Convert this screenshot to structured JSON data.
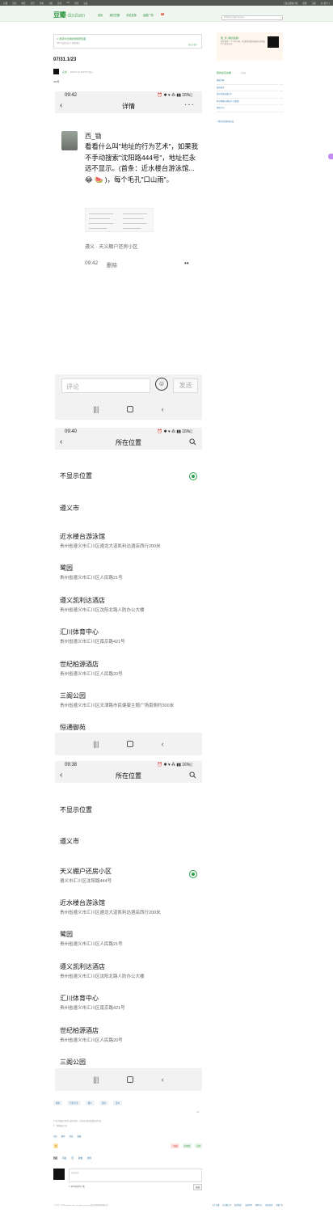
{
  "gnav": {
    "left": [
      "豆瓣",
      "读书",
      "电影",
      "音乐",
      "同城",
      "小组",
      "阅读",
      "FM",
      "时间",
      "豆品"
    ],
    "right": [
      "下载豆瓣客户端",
      "提醒",
      "豆邮",
      "的_帐号 ▾"
    ]
  },
  "header": {
    "logo": "豆瓣",
    "logo_sub": "douban",
    "nav": [
      "首页",
      "我的豆瓣",
      "浏览发现",
      "话题广场"
    ],
    "nav_badge": "新",
    "search_placeholder": "搜索你感兴趣的内容和人..."
  },
  "group": {
    "name": "吴京中文网的建筑研究组",
    "meta": "300个成员在此  小组管理员",
    "join": "加入小组 ›"
  },
  "post": {
    "title": "07/31.1/23",
    "author": "良 鹤",
    "time": "2023-07-31 09:15:51 贵州",
    "body_prefix": "444号"
  },
  "phone1": {
    "status_time": "09:42",
    "status_right": "⏰ ✱ ▾ ⁂ ▮▮ 16%▯",
    "title": "详情",
    "username": "西_锄",
    "content": "看看什么叫\"地址的行为艺术\"，如果我不手动搜索\"沈阳路444号\"，地址栏永远不显示。(首条：近水楼台游泳馆...😂 🍉 )，每个毛孔\"口山雨\"。",
    "location": "遵义 · 天义棚户还房小区",
    "post_time": "09:42",
    "delete": "删除",
    "dots": "••"
  },
  "phone2": {
    "input_placeholder": "评论",
    "emoji": "☺",
    "send": "发送"
  },
  "phone3": {
    "status_time": "09:40",
    "status_right": "⏰ ✱ ▾ ⁂ ▮▮ 16%▯",
    "title": "所在位置",
    "items": [
      {
        "title": "不显示位置",
        "sub": ""
      },
      {
        "title": "遵义市",
        "sub": ""
      },
      {
        "title": "近水楼台游泳馆",
        "sub": "贵州省遵义市汇川区遵龙大道凯利达酒店西行200米"
      },
      {
        "title": "鹭园",
        "sub": "贵州省遵义市汇川区人民路21号"
      },
      {
        "title": "遵义凯利达酒店",
        "sub": "贵州省遵义市汇川区沈阳北路人防办公大楼"
      },
      {
        "title": "汇川体育中心",
        "sub": "贵州省遵义市汇川区南京路421号"
      },
      {
        "title": "世纪柏源酒店",
        "sub": "贵州省遵义市汇川区人民路20号"
      },
      {
        "title": "三阁公园",
        "sub": "贵州省遵义市汇川区天津路市民健康主题广场南侧约300米"
      },
      {
        "title": "恒通御苑",
        "sub": ""
      }
    ]
  },
  "phone4": {
    "status_time": "09:38",
    "status_right": "⏰ ✱ ▾ ⁂ ▮▮ 16%▯",
    "title": "所在位置",
    "items": [
      {
        "title": "不显示位置",
        "sub": ""
      },
      {
        "title": "遵义市",
        "sub": ""
      },
      {
        "title": "天义棚户还房小区",
        "sub": "遵义市汇川区沈阳路444号"
      },
      {
        "title": "近水楼台游泳馆",
        "sub": "贵州省遵义市汇川区遵龙大道凯利达酒店西行200米"
      },
      {
        "title": "鹭园",
        "sub": "贵州省遵义市汇川区人民路21号"
      },
      {
        "title": "遵义凯利达酒店",
        "sub": "贵州省遵义市汇川区沈阳北路人防办公大楼"
      },
      {
        "title": "汇川体育中心",
        "sub": "贵州省遵义市汇川区南京路421号"
      },
      {
        "title": "世纪柏源酒店",
        "sub": "贵州省遵义市汇川区人民路20号"
      },
      {
        "title": "三阁公园",
        "sub": ""
      }
    ]
  },
  "tags": [
    "地址",
    "行为艺术",
    "遵义",
    "定位",
    "贵州"
  ],
  "page_count": "1/2",
  "copyright_note": "© 本文版权归作者 良鹤 所有，任何形式转载请联系作者。",
  "copyright_note2": "© 了解版权计划",
  "actions": [
    "回应",
    "推荐",
    "转发",
    "收藏"
  ],
  "likebar": {
    "left": "赞",
    "right": [
      "☆收藏",
      "✉ 推荐",
      "分享"
    ]
  },
  "comment_nav": [
    "回应",
    "转发",
    "赞",
    "收藏",
    "推荐"
  ],
  "comment": {
    "placeholder": "添加回应",
    "checkbox": "☐ 同时转发到广播",
    "submit": "发送"
  },
  "footer": {
    "copy": "© 2005－2023 douban.com, all rights reserved 北京豆网科技有限公司",
    "links": [
      "关于豆瓣",
      "在豆瓣工作",
      "联系我们",
      "法律声明",
      "帮助中心",
      "移动应用",
      "豆瓣广告"
    ]
  },
  "sidebar": {
    "card_title": "吴_京 (我的豆瓣)",
    "card_desc": "这里是我一个人的小组，欢迎喜欢建筑和城市的朋友们一起来讨论",
    "recent_head": "我的最近在看",
    "recent_more": "(全部)",
    "recent": [
      "建筑学家",
      "城市研究",
      "遵义的地址是什么",
      "时空地图与地址(人人都是)",
      "地址行为"
    ],
    "more_link": "> 我的全部发帖信息"
  }
}
